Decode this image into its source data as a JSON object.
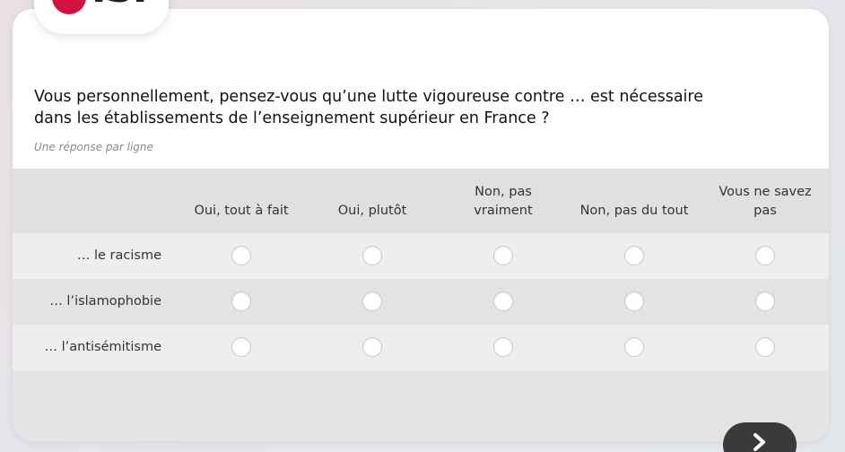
{
  "logo": {
    "text": "ISP",
    "accent_color": "#d3123f"
  },
  "question": {
    "text": "Vous personnellement, pensez-vous qu’une lutte vigoureuse contre … est nécessaire dans les établissements de l’enseignement supérieur en France ?",
    "hint": "Une réponse par ligne"
  },
  "columns": [
    {
      "label": "Oui, tout à fait"
    },
    {
      "label": "Oui, plutôt"
    },
    {
      "label": "Non, pas vraiment"
    },
    {
      "label": "Non, pas du tout"
    },
    {
      "label": "Vous ne savez pas"
    }
  ],
  "rows": [
    {
      "label": "… le racisme"
    },
    {
      "label": "… l’islamophobie"
    },
    {
      "label": "… l’antisémitisme"
    }
  ],
  "navigation": {
    "next_icon": "chevron-right-icon"
  }
}
